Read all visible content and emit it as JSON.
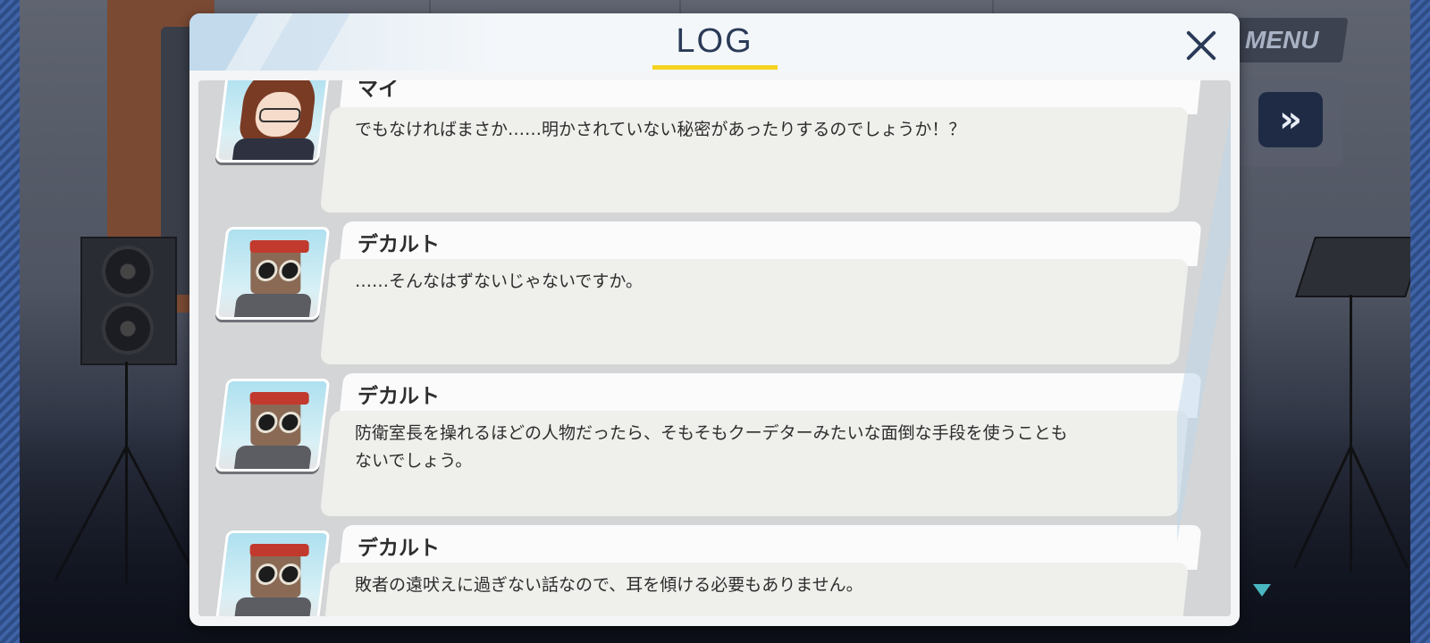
{
  "header": {
    "title": "LOG",
    "close_icon": "close-icon"
  },
  "background": {
    "menu_label": "MENU",
    "fast_forward_icon": "fast-forward-icon",
    "scroll_indicator_icon": "scroll-down-icon"
  },
  "log": {
    "entries": [
      {
        "speaker": "マイ",
        "avatar": "mai-portrait",
        "text": "でもなければまさか……明かされていない秘密があったりするのでしょうか！？"
      },
      {
        "speaker": "デカルト",
        "avatar": "decart-portrait",
        "text": "……そんなはずないじゃないですか。"
      },
      {
        "speaker": "デカルト",
        "avatar": "decart-portrait",
        "text": "防衛室長を操れるほどの人物だったら、そもそもクーデターみたいな面倒な手段を使うことも\nないでしょう。"
      },
      {
        "speaker": "デカルト",
        "avatar": "decart-portrait",
        "text": "敗者の遠吠えに過ぎない話なので、耳を傾ける必要もありません。"
      }
    ]
  },
  "colors": {
    "title": "#2a3a57",
    "underline": "#f5d320",
    "bubble": "#efefec",
    "name_tab": "#fbfbfb"
  }
}
